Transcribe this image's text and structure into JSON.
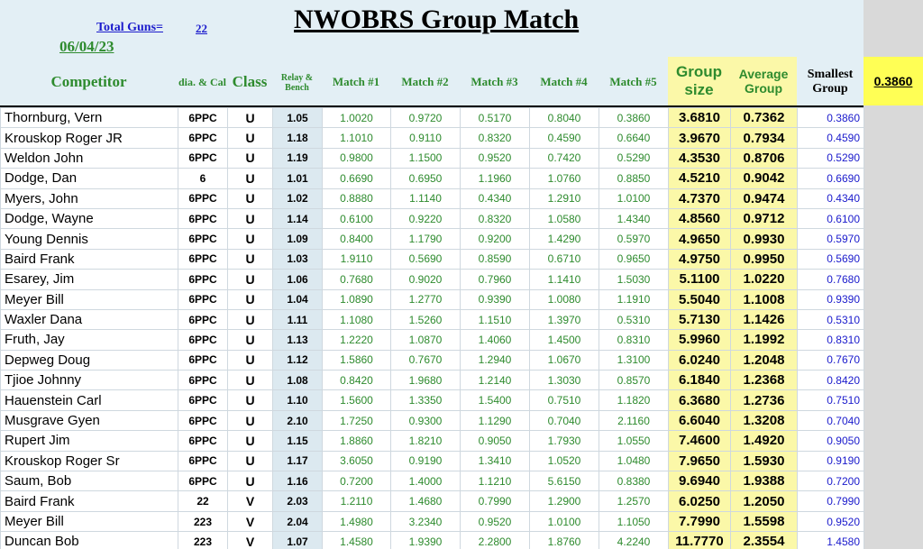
{
  "title": "NWOBRS Group Match",
  "total_guns_label": "Total Guns=",
  "total_guns": "22",
  "date": "06/04/23",
  "best_smallest": "0.3860",
  "headers": {
    "competitor": "Competitor",
    "dia_cal": "dia. & Cal",
    "class": "Class",
    "relay_bench": "Relay & Bench",
    "match1": "Match #1",
    "match2": "Match #2",
    "match3": "Match #3",
    "match4": "Match #4",
    "match5": "Match #5",
    "group_size": "Group size",
    "average_group": "Average Group",
    "smallest_group": "Smallest Group"
  },
  "rows": [
    {
      "name": "Thornburg, Vern",
      "cal": "6PPC",
      "cls": "U",
      "relay": "1.05",
      "m1": "1.0020",
      "m2": "0.9720",
      "m3": "0.5170",
      "m4": "0.8040",
      "m5": "0.3860",
      "gs": "3.6810",
      "avg": "0.7362",
      "small": "0.3860"
    },
    {
      "name": "Krouskop Roger JR",
      "cal": "6PPC",
      "cls": "U",
      "relay": "1.18",
      "m1": "1.1010",
      "m2": "0.9110",
      "m3": "0.8320",
      "m4": "0.4590",
      "m5": "0.6640",
      "gs": "3.9670",
      "avg": "0.7934",
      "small": "0.4590"
    },
    {
      "name": "Weldon John",
      "cal": "6PPC",
      "cls": "U",
      "relay": "1.19",
      "m1": "0.9800",
      "m2": "1.1500",
      "m3": "0.9520",
      "m4": "0.7420",
      "m5": "0.5290",
      "gs": "4.3530",
      "avg": "0.8706",
      "small": "0.5290"
    },
    {
      "name": "Dodge, Dan",
      "cal": "6",
      "cls": "U",
      "relay": "1.01",
      "m1": "0.6690",
      "m2": "0.6950",
      "m3": "1.1960",
      "m4": "1.0760",
      "m5": "0.8850",
      "gs": "4.5210",
      "avg": "0.9042",
      "small": "0.6690"
    },
    {
      "name": "Myers, John",
      "cal": "6PPC",
      "cls": "U",
      "relay": "1.02",
      "m1": "0.8880",
      "m2": "1.1140",
      "m3": "0.4340",
      "m4": "1.2910",
      "m5": "1.0100",
      "gs": "4.7370",
      "avg": "0.9474",
      "small": "0.4340"
    },
    {
      "name": "Dodge, Wayne",
      "cal": "6PPC",
      "cls": "U",
      "relay": "1.14",
      "m1": "0.6100",
      "m2": "0.9220",
      "m3": "0.8320",
      "m4": "1.0580",
      "m5": "1.4340",
      "gs": "4.8560",
      "avg": "0.9712",
      "small": "0.6100"
    },
    {
      "name": "Young Dennis",
      "cal": "6PPC",
      "cls": "U",
      "relay": "1.09",
      "m1": "0.8400",
      "m2": "1.1790",
      "m3": "0.9200",
      "m4": "1.4290",
      "m5": "0.5970",
      "gs": "4.9650",
      "avg": "0.9930",
      "small": "0.5970"
    },
    {
      "name": "Baird Frank",
      "cal": "6PPC",
      "cls": "U",
      "relay": "1.03",
      "m1": "1.9110",
      "m2": "0.5690",
      "m3": "0.8590",
      "m4": "0.6710",
      "m5": "0.9650",
      "gs": "4.9750",
      "avg": "0.9950",
      "small": "0.5690"
    },
    {
      "name": "Esarey, Jim",
      "cal": "6PPC",
      "cls": "U",
      "relay": "1.06",
      "m1": "0.7680",
      "m2": "0.9020",
      "m3": "0.7960",
      "m4": "1.1410",
      "m5": "1.5030",
      "gs": "5.1100",
      "avg": "1.0220",
      "small": "0.7680"
    },
    {
      "name": "Meyer Bill",
      "cal": "6PPC",
      "cls": "U",
      "relay": "1.04",
      "m1": "1.0890",
      "m2": "1.2770",
      "m3": "0.9390",
      "m4": "1.0080",
      "m5": "1.1910",
      "gs": "5.5040",
      "avg": "1.1008",
      "small": "0.9390"
    },
    {
      "name": "Waxler Dana",
      "cal": "6PPC",
      "cls": "U",
      "relay": "1.11",
      "m1": "1.1080",
      "m2": "1.5260",
      "m3": "1.1510",
      "m4": "1.3970",
      "m5": "0.5310",
      "gs": "5.7130",
      "avg": "1.1426",
      "small": "0.5310"
    },
    {
      "name": "Fruth, Jay",
      "cal": "6PPC",
      "cls": "U",
      "relay": "1.13",
      "m1": "1.2220",
      "m2": "1.0870",
      "m3": "1.4060",
      "m4": "1.4500",
      "m5": "0.8310",
      "gs": "5.9960",
      "avg": "1.1992",
      "small": "0.8310"
    },
    {
      "name": "Depweg Doug",
      "cal": "6PPC",
      "cls": "U",
      "relay": "1.12",
      "m1": "1.5860",
      "m2": "0.7670",
      "m3": "1.2940",
      "m4": "1.0670",
      "m5": "1.3100",
      "gs": "6.0240",
      "avg": "1.2048",
      "small": "0.7670"
    },
    {
      "name": "Tjioe Johnny",
      "cal": "6PPC",
      "cls": "U",
      "relay": "1.08",
      "m1": "0.8420",
      "m2": "1.9680",
      "m3": "1.2140",
      "m4": "1.3030",
      "m5": "0.8570",
      "gs": "6.1840",
      "avg": "1.2368",
      "small": "0.8420"
    },
    {
      "name": "Hauenstein Carl",
      "cal": "6PPC",
      "cls": "U",
      "relay": "1.10",
      "m1": "1.5600",
      "m2": "1.3350",
      "m3": "1.5400",
      "m4": "0.7510",
      "m5": "1.1820",
      "gs": "6.3680",
      "avg": "1.2736",
      "small": "0.7510"
    },
    {
      "name": "Musgrave Gyen",
      "cal": "6PPC",
      "cls": "U",
      "relay": "2.10",
      "m1": "1.7250",
      "m2": "0.9300",
      "m3": "1.1290",
      "m4": "0.7040",
      "m5": "2.1160",
      "gs": "6.6040",
      "avg": "1.3208",
      "small": "0.7040"
    },
    {
      "name": "Rupert Jim",
      "cal": "6PPC",
      "cls": "U",
      "relay": "1.15",
      "m1": "1.8860",
      "m2": "1.8210",
      "m3": "0.9050",
      "m4": "1.7930",
      "m5": "1.0550",
      "gs": "7.4600",
      "avg": "1.4920",
      "small": "0.9050"
    },
    {
      "name": "Krouskop Roger Sr",
      "cal": "6PPC",
      "cls": "U",
      "relay": "1.17",
      "m1": "3.6050",
      "m2": "0.9190",
      "m3": "1.3410",
      "m4": "1.0520",
      "m5": "1.0480",
      "gs": "7.9650",
      "avg": "1.5930",
      "small": "0.9190"
    },
    {
      "name": "Saum, Bob",
      "cal": "6PPC",
      "cls": "U",
      "relay": "1.16",
      "m1": "0.7200",
      "m2": "1.4000",
      "m3": "1.1210",
      "m4": "5.6150",
      "m5": "0.8380",
      "gs": "9.6940",
      "avg": "1.9388",
      "small": "0.7200"
    },
    {
      "name": "Baird Frank",
      "cal": "22",
      "cls": "V",
      "relay": "2.03",
      "m1": "1.2110",
      "m2": "1.4680",
      "m3": "0.7990",
      "m4": "1.2900",
      "m5": "1.2570",
      "gs": "6.0250",
      "avg": "1.2050",
      "small": "0.7990"
    },
    {
      "name": "Meyer Bill",
      "cal": "223",
      "cls": "V",
      "relay": "2.04",
      "m1": "1.4980",
      "m2": "3.2340",
      "m3": "0.9520",
      "m4": "1.0100",
      "m5": "1.1050",
      "gs": "7.7990",
      "avg": "1.5598",
      "small": "0.9520"
    },
    {
      "name": "Duncan Bob",
      "cal": "223",
      "cls": "V",
      "relay": "1.07",
      "m1": "1.4580",
      "m2": "1.9390",
      "m3": "2.2800",
      "m4": "1.8760",
      "m5": "4.2240",
      "gs": "11.7770",
      "avg": "2.3554",
      "small": "1.4580"
    }
  ]
}
